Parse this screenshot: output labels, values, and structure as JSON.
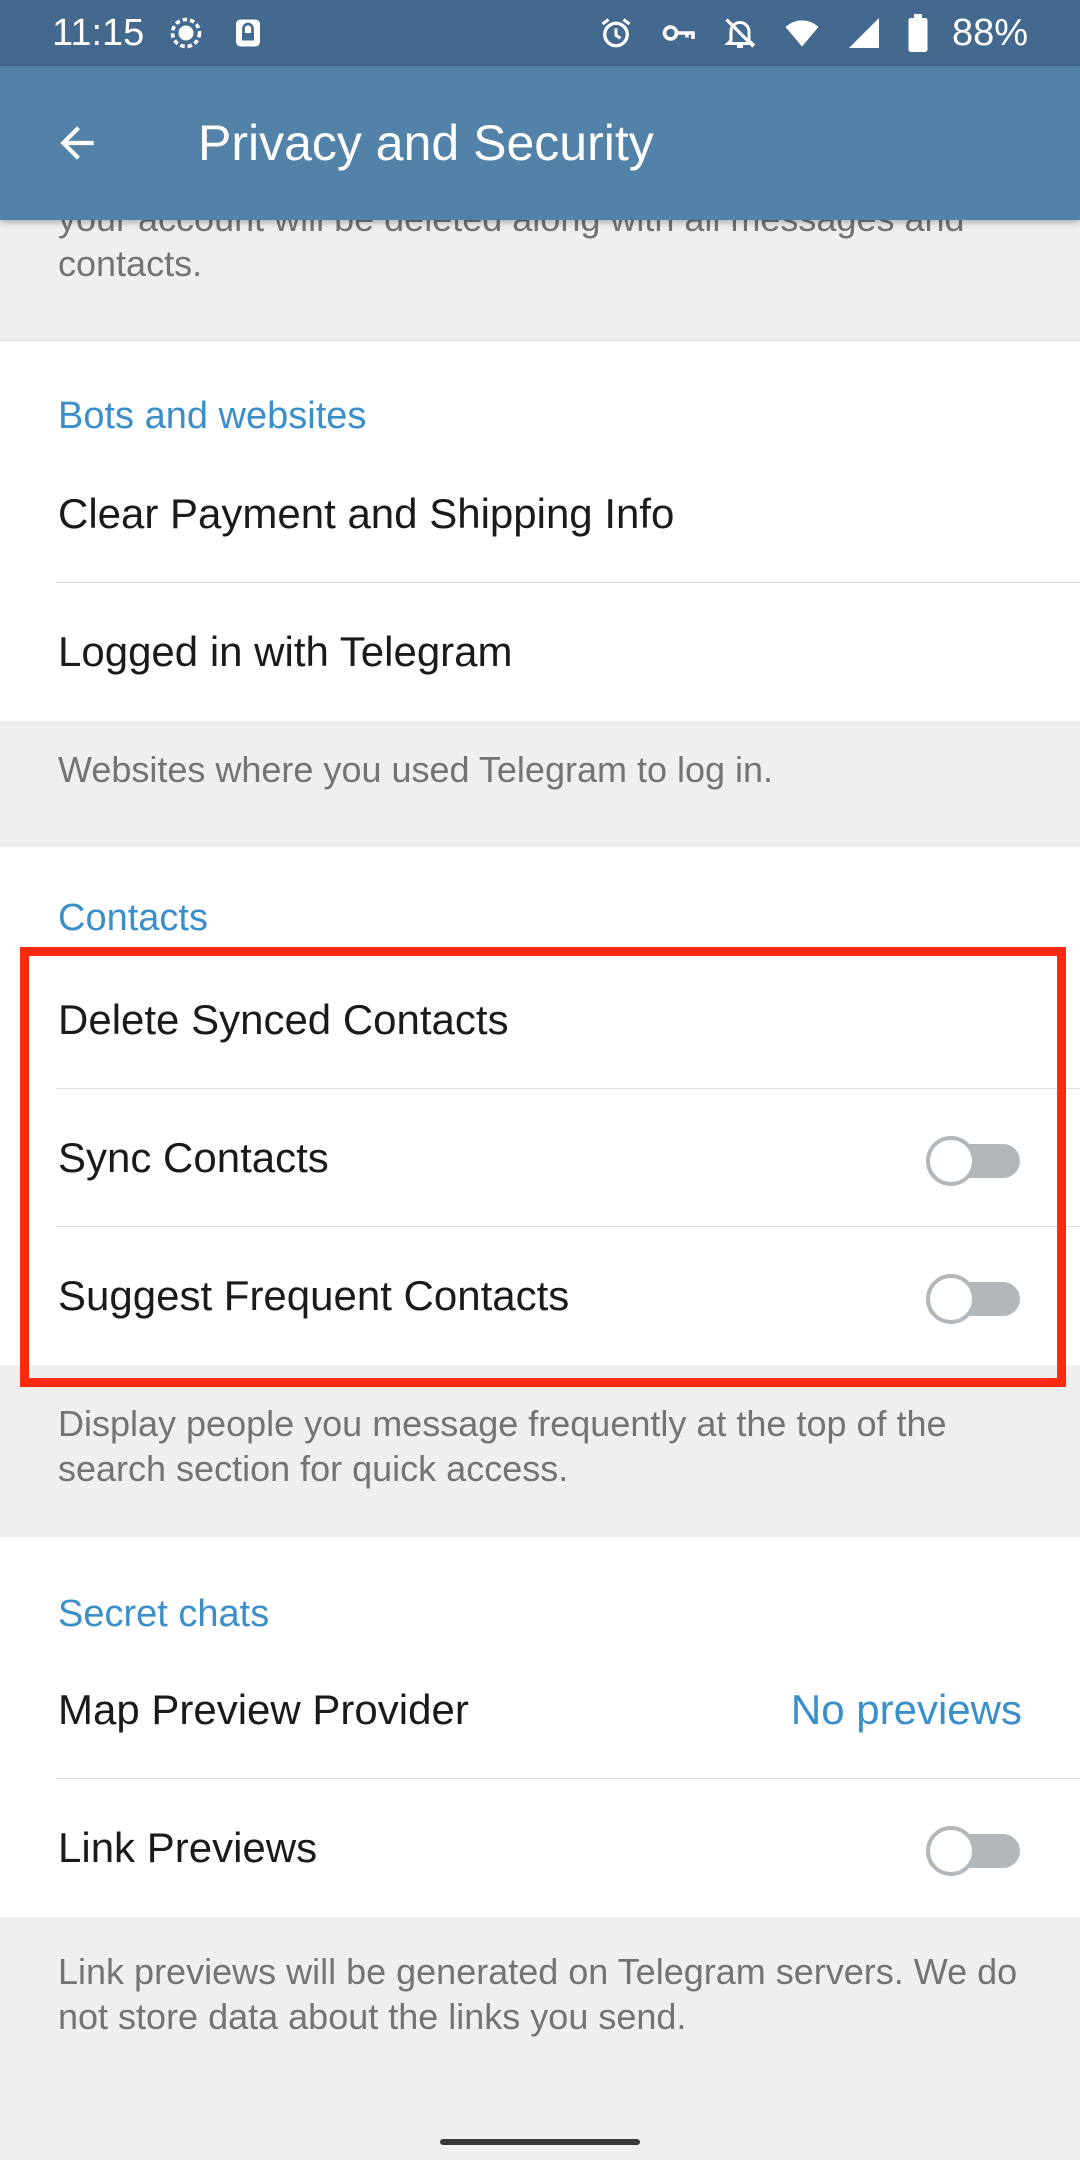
{
  "status_bar": {
    "time": "11:15",
    "battery": "88%",
    "icons": [
      "signal-app-icon",
      "lock-badge-icon",
      "alarm-icon",
      "vpn-key-icon",
      "bell-off-icon",
      "wifi-icon",
      "cell-signal-icon",
      "battery-icon"
    ]
  },
  "app_bar": {
    "title": "Privacy and Security",
    "back_icon": "arrow-back-icon"
  },
  "delete_account": {
    "info": "your account will be deleted along with all messages and contacts."
  },
  "bots": {
    "header": "Bots and websites",
    "items": [
      {
        "label": "Clear Payment and Shipping Info"
      },
      {
        "label": "Logged in with Telegram"
      }
    ],
    "info": "Websites where you used Telegram to log in."
  },
  "contacts": {
    "header": "Contacts",
    "items": [
      {
        "label": "Delete Synced Contacts"
      },
      {
        "label": "Sync Contacts",
        "toggle": false
      },
      {
        "label": "Suggest Frequent Contacts",
        "toggle": false
      }
    ],
    "info": "Display people you message frequently at the top of the search section for quick access."
  },
  "secret_chats": {
    "header": "Secret chats",
    "items": [
      {
        "label": "Map Preview Provider",
        "value": "No previews"
      },
      {
        "label": "Link Previews",
        "toggle": false
      }
    ],
    "info": "Link previews will be generated on Telegram servers. We do not store data about the links you send."
  },
  "colors": {
    "status_bar": "#44698f",
    "app_bar": "#5282a8",
    "accent": "#3a8fcb",
    "highlight": "#ff2a10"
  }
}
